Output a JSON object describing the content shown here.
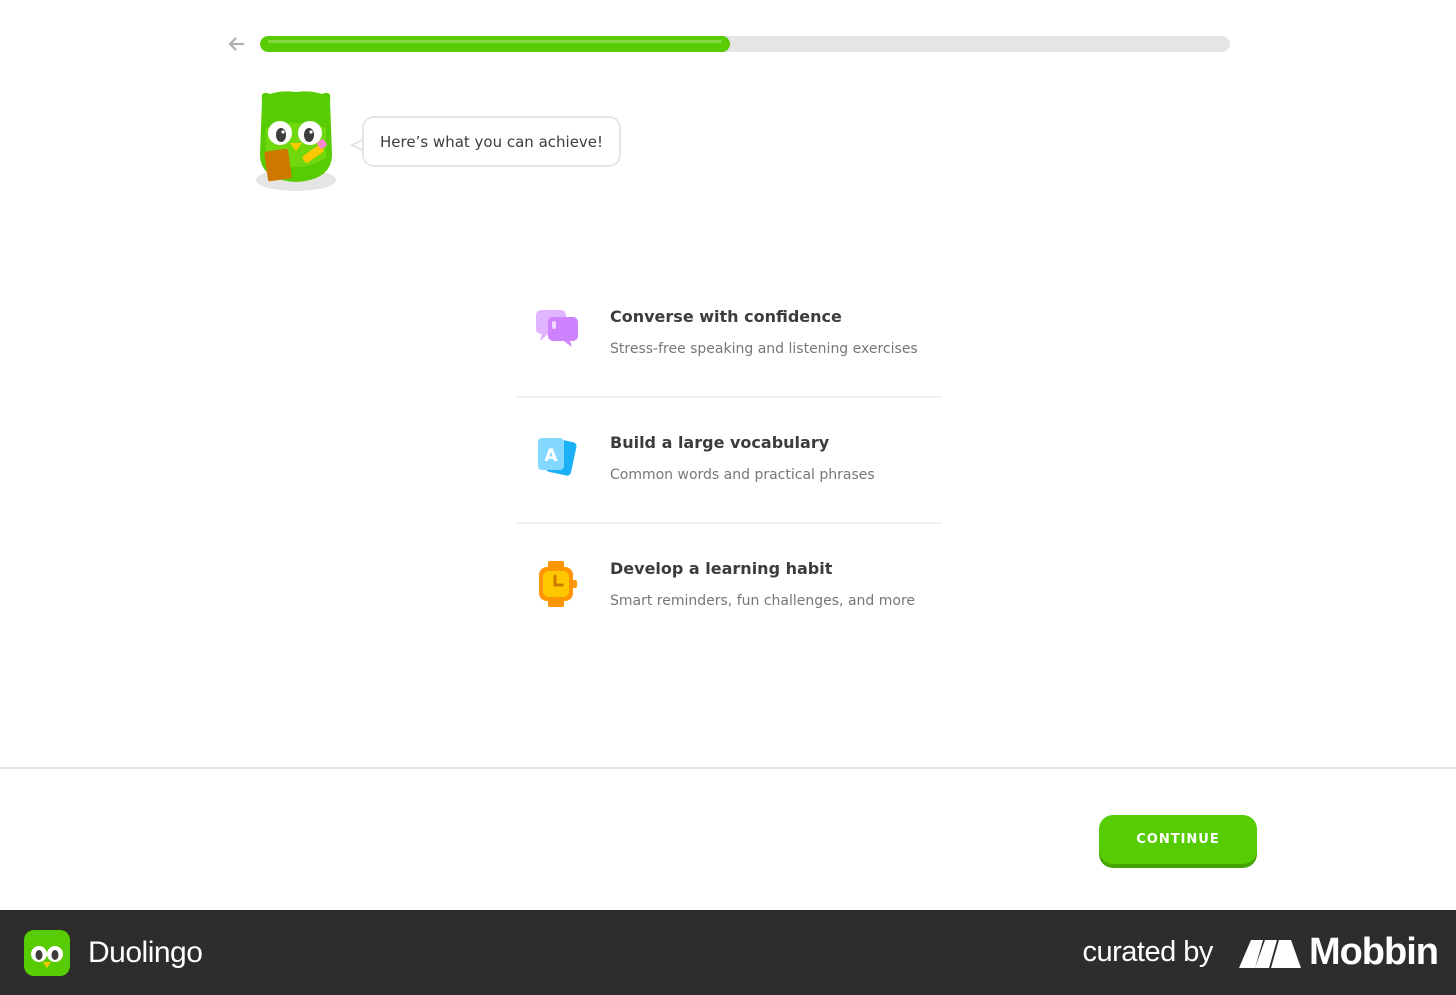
{
  "header": {
    "back_icon": "arrow-left-icon",
    "progress": 0.485,
    "progress_color": "#58cc02",
    "track_color": "#e5e5e5"
  },
  "mascot": {
    "icon": "duo-owl-icon",
    "message": "Here’s what you can achieve!"
  },
  "features": [
    {
      "icon": "chat-bubbles-icon",
      "title": "Converse with confidence",
      "description": "Stress-free speaking and listening exercises"
    },
    {
      "icon": "vocabulary-cards-icon",
      "title": "Build a large vocabulary",
      "description": "Common words and practical phrases"
    },
    {
      "icon": "watch-clock-icon",
      "title": "Develop a learning habit",
      "description": "Smart reminders, fun challenges, and more"
    }
  ],
  "footer": {
    "continue_label": "CONTINUE",
    "button_color": "#58cc02"
  },
  "branding": {
    "app_name": "Duolingo",
    "curated_by": "curated by",
    "curator_name": "Mobbin",
    "bar_color": "#2d2d2d"
  }
}
